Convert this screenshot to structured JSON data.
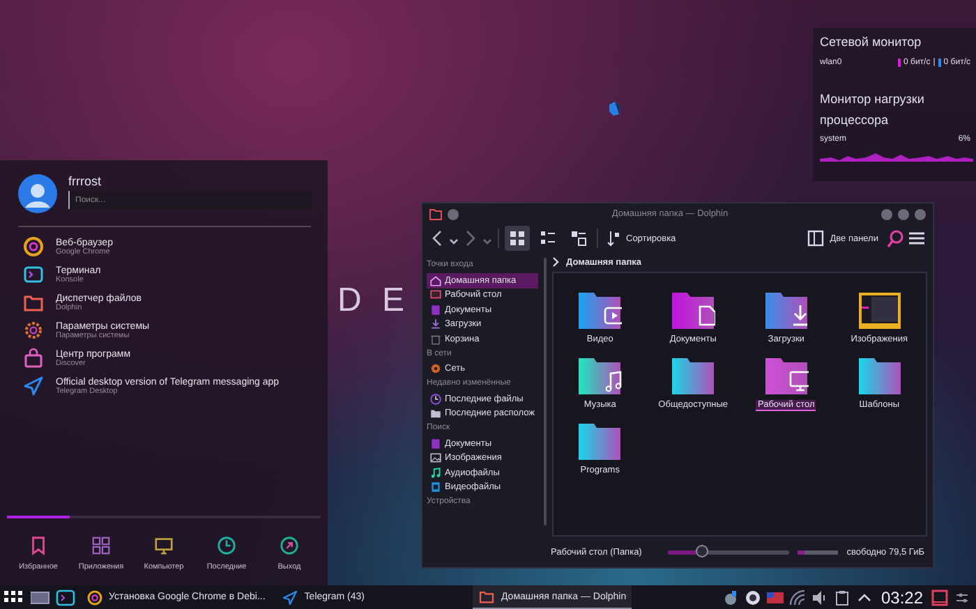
{
  "wallpaper_text": "D E",
  "widgets": {
    "network": {
      "title": "Сетевой монитор",
      "interface": "wlan0",
      "download": "0 бит/с",
      "separator": "|",
      "upload": "0 бит/с"
    },
    "cpu": {
      "title": "Монитор нагрузки процессора",
      "label": "system",
      "value": "6%"
    }
  },
  "launcher": {
    "user": "frrrost",
    "search": {
      "placeholder": "Поиск..."
    },
    "apps": [
      {
        "name": "Веб-браузер",
        "subtitle": "Google Chrome",
        "kind": "browser"
      },
      {
        "name": "Терминал",
        "subtitle": "Konsole",
        "kind": "terminal"
      },
      {
        "name": "Диспетчер файлов",
        "subtitle": "Dolphin",
        "kind": "folder"
      },
      {
        "name": "Параметры системы",
        "subtitle": "Параметры системы",
        "kind": "gear"
      },
      {
        "name": "Центр программ",
        "subtitle": "Discover",
        "kind": "bag"
      },
      {
        "name": "Official desktop version of Telegram messaging app",
        "subtitle": "Telegram Desktop",
        "kind": "plane"
      }
    ],
    "tabs": [
      {
        "label": "Избранное",
        "kind": "bookmark",
        "selected": true
      },
      {
        "label": "Приложения",
        "kind": "grid",
        "selected": false
      },
      {
        "label": "Компьютер",
        "kind": "monitor",
        "selected": false
      },
      {
        "label": "Последние",
        "kind": "clock",
        "selected": false
      },
      {
        "label": "Выход",
        "kind": "exit",
        "selected": false
      }
    ]
  },
  "dolphin": {
    "title": "Домашняя папка — Dolphin",
    "view_modes": [
      {
        "selected": true
      },
      {
        "selected": false
      },
      {
        "selected": false
      }
    ],
    "sort_button": "Сортировка",
    "split_button": "Две панели",
    "sidebar": [
      {
        "title": "Точки входа",
        "items": [
          {
            "label": "Домашняя папка",
            "kind": "home",
            "selected": true
          },
          {
            "label": "Рабочий стол",
            "kind": "desktop",
            "selected": false
          },
          {
            "label": "Документы",
            "kind": "document",
            "selected": false
          },
          {
            "label": "Загрузки",
            "kind": "download",
            "selected": false
          },
          {
            "label": "Корзина",
            "kind": "trash",
            "selected": false
          }
        ]
      },
      {
        "title": "В сети",
        "items": [
          {
            "label": "Сеть",
            "kind": "network",
            "selected": false
          }
        ]
      },
      {
        "title": "Недавно изменённые",
        "items": [
          {
            "label": "Последние файлы",
            "kind": "clock",
            "selected": false
          },
          {
            "label": "Последние располож",
            "kind": "folder",
            "selected": false
          }
        ]
      },
      {
        "title": "Поиск",
        "items": [
          {
            "label": "Документы",
            "kind": "document",
            "selected": false
          },
          {
            "label": "Изображения",
            "kind": "image",
            "selected": false
          },
          {
            "label": "Аудиофайлы",
            "kind": "audio",
            "selected": false
          },
          {
            "label": "Видеофайлы",
            "kind": "video",
            "selected": false
          }
        ]
      },
      {
        "title": "Устройства"
      }
    ],
    "breadcrumb": "Домашняя папка",
    "folders": [
      {
        "label": "Видео",
        "kind": "video",
        "selected": false
      },
      {
        "label": "Документы",
        "kind": "document",
        "selected": false
      },
      {
        "label": "Загрузки",
        "kind": "download",
        "selected": false
      },
      {
        "label": "Изображения",
        "kind": "image",
        "selected": false
      },
      {
        "label": "Музыка",
        "kind": "music",
        "selected": false
      },
      {
        "label": "Общедоступные",
        "kind": "plain",
        "selected": false
      },
      {
        "label": "Рабочий стол",
        "kind": "desktop",
        "selected": true
      },
      {
        "label": "Шаблоны",
        "kind": "plain",
        "selected": false
      },
      {
        "label": "Programs",
        "kind": "plain",
        "selected": false
      }
    ],
    "status": "Рабочий стол (Папка)",
    "zoom": {
      "level": 0.28
    },
    "free_space": {
      "label": "свободно 79,5 ГиБ",
      "level": 0.18
    }
  },
  "taskbar": {
    "tasks": [
      {
        "label": "Установка Google Chrome в Debi...",
        "kind": "browser",
        "active": false
      },
      {
        "label": "Telegram (43)",
        "kind": "plane",
        "active": false
      },
      {
        "label": "Домашняя папка — Dolphin",
        "kind": "folder",
        "active": true
      }
    ],
    "clock": "03:22"
  }
}
